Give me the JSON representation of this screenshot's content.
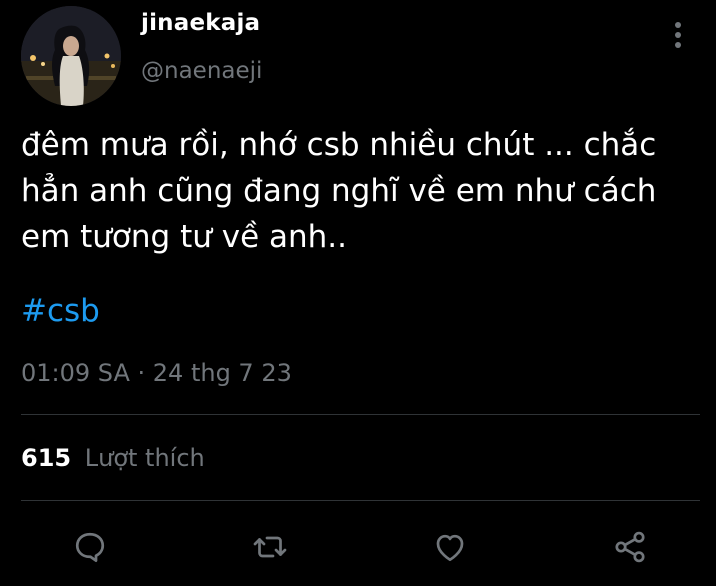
{
  "tweet": {
    "display_name": "jinaekaja",
    "handle": "@naenaeji",
    "text": "đêm mưa rồi, nhớ csb nhiều chút ... chắc\nhẳn anh cũng đang nghĩ về em như cách\nem tương tư về anh..",
    "hashtag": "#csb",
    "timestamp": "01:09 SA · 24 thg 7 23"
  },
  "stats": {
    "likes_count": "615",
    "likes_label": "Lượt thích"
  },
  "icons": {
    "more": "vertical-ellipsis-icon",
    "reply": "speech-bubble-icon",
    "retweet": "retweet-arrows-icon",
    "like": "heart-outline-icon",
    "share": "share-nodes-icon"
  },
  "colors": {
    "background": "#000000",
    "text": "#ffffff",
    "secondary": "#71767b",
    "link": "#1d9bf0",
    "divider": "#2f3336"
  }
}
